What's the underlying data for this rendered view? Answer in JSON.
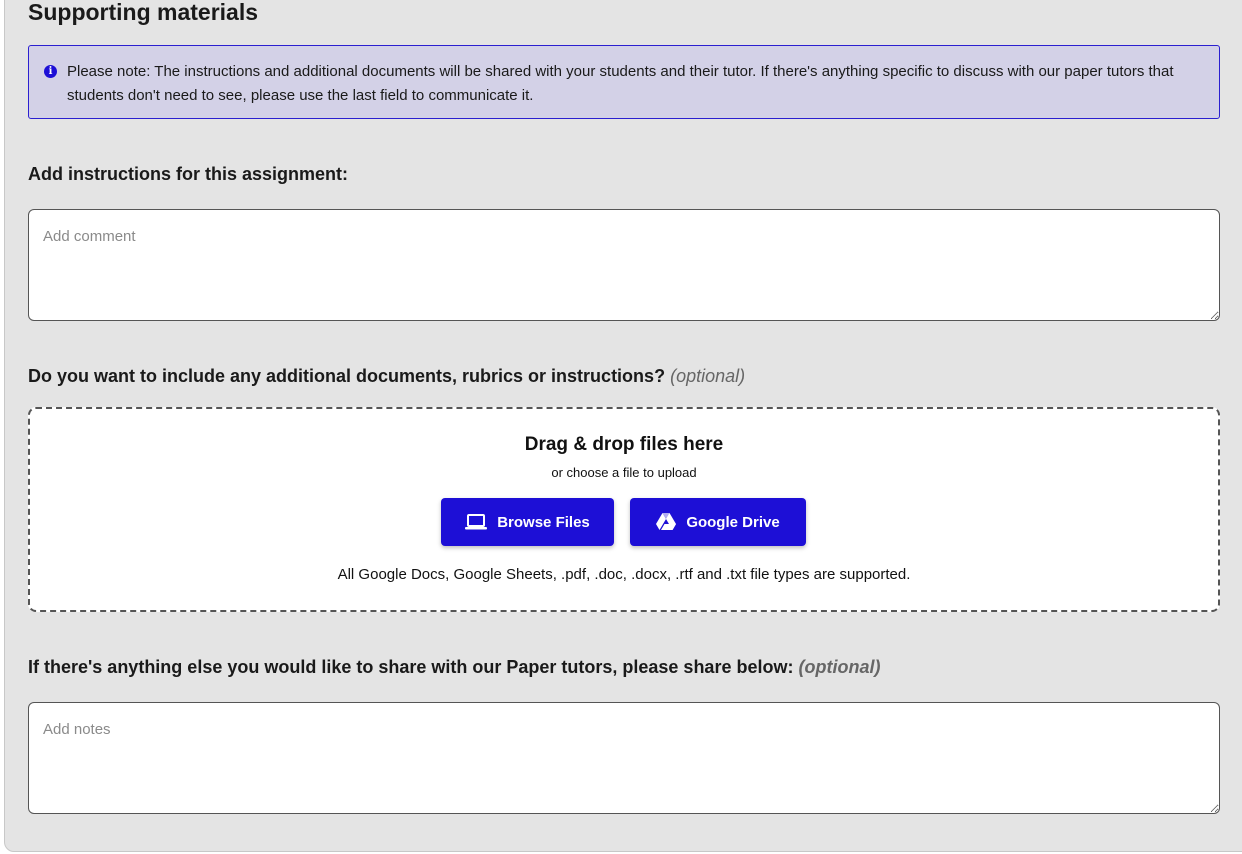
{
  "section": {
    "title": "Supporting materials"
  },
  "notice": {
    "icon": "info-icon",
    "text": "Please note: The instructions and additional documents will be shared with your students and their tutor. If there's anything specific to discuss with our paper tutors that students don't need to see, please use the last field to communicate it."
  },
  "instructions": {
    "label": "Add instructions for this assignment:",
    "placeholder": "Add comment",
    "value": ""
  },
  "documents": {
    "label": "Do you want to include any additional documents, rubrics or instructions?",
    "optional": "(optional)",
    "dropzone": {
      "title": "Drag & drop files here",
      "subtitle": "or choose a file to upload",
      "browse_label": "Browse Files",
      "browse_icon": "laptop-icon",
      "drive_label": "Google Drive",
      "drive_icon": "google-drive-icon",
      "supported": "All Google Docs, Google Sheets, .pdf, .doc, .docx, .rtf and .txt file types are supported."
    }
  },
  "notes": {
    "label": "If there's anything else you would like to share with our Paper tutors, please share below:",
    "optional": "(optional)",
    "placeholder": "Add notes",
    "value": ""
  },
  "colors": {
    "accent": "#1d0fd6",
    "notice_bg": "#d3d1e7",
    "panel_bg": "#e4e4e4"
  }
}
